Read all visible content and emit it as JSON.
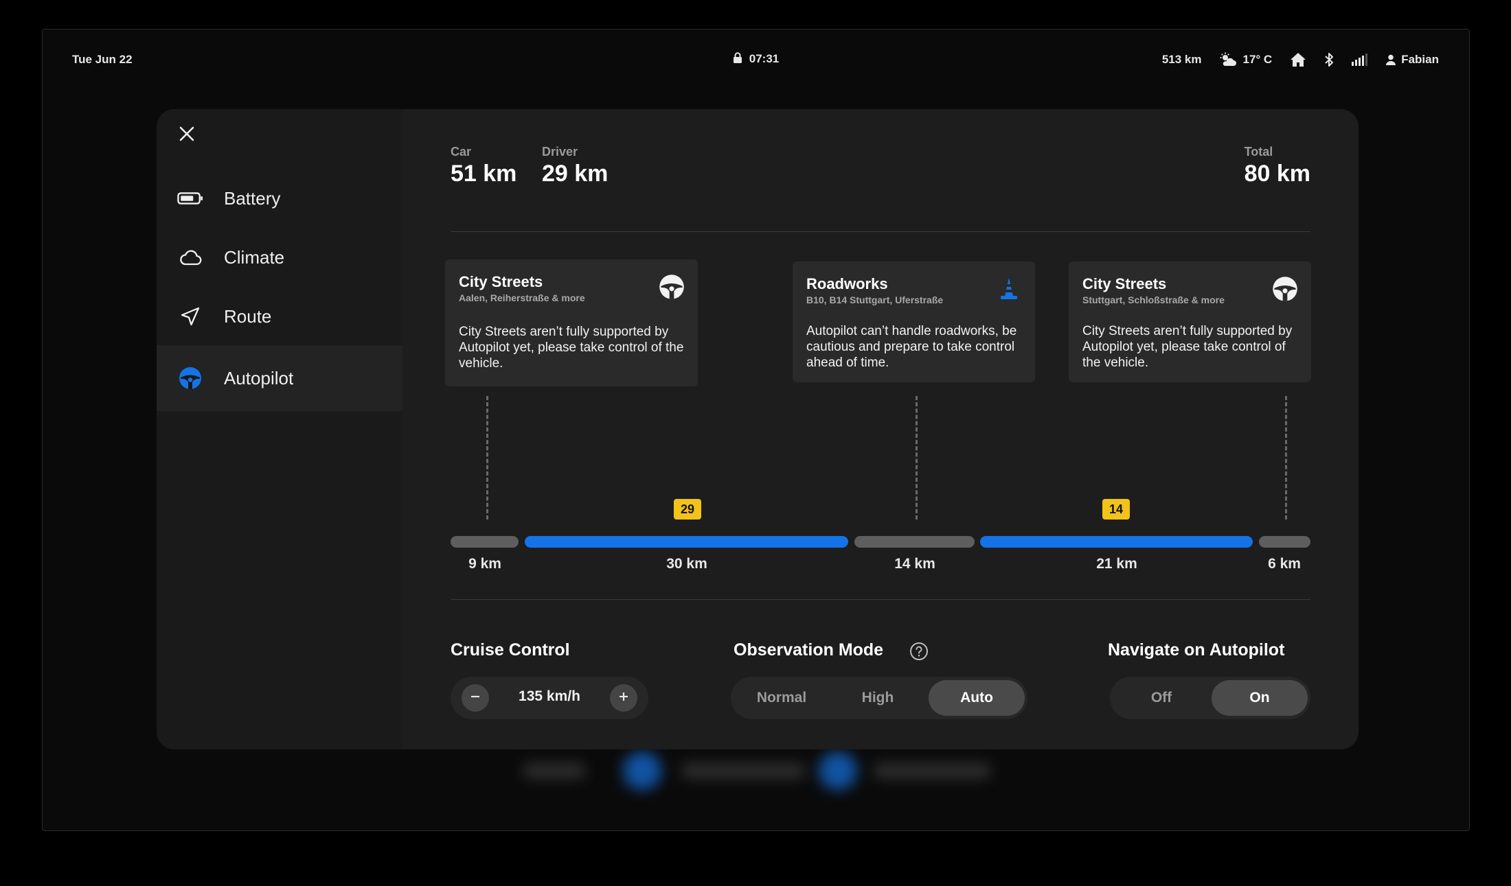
{
  "status": {
    "date": "Tue Jun 22",
    "time": "07:31",
    "range": "513 km",
    "temperature": "17° C",
    "user": "Fabian"
  },
  "sidebar": {
    "items": [
      {
        "label": "Battery",
        "icon": "battery-icon",
        "active": false
      },
      {
        "label": "Climate",
        "icon": "cloud-icon",
        "active": false
      },
      {
        "label": "Route",
        "icon": "navigation-arrow-icon",
        "active": false
      },
      {
        "label": "Autopilot",
        "icon": "steering-wheel-icon",
        "active": true
      }
    ]
  },
  "distances": {
    "car": {
      "label": "Car",
      "value": "51 km"
    },
    "driver": {
      "label": "Driver",
      "value": "29 km"
    },
    "total": {
      "label": "Total",
      "value": "80 km"
    }
  },
  "cards": [
    {
      "title": "City Streets",
      "subtitle": "Aalen, Reiherstraße & more",
      "body": "City Streets aren’t fully supported by Autopilot yet, please take control of the vehicle.",
      "icon": "steering-wheel-icon"
    },
    {
      "title": "Roadworks",
      "subtitle": "B10, B14 Stuttgart, Uferstraße",
      "body": "Autopilot can’t handle roadworks, be cautious and prepare to take control ahead of time.",
      "icon": "traffic-cone-icon"
    },
    {
      "title": "City Streets",
      "subtitle": "Stuttgart, Schloßstraße & more",
      "body": "City Streets aren’t fully supported by Autopilot yet, please take control of the vehicle.",
      "icon": "steering-wheel-icon"
    }
  ],
  "route": {
    "segments": [
      {
        "label": "9 km",
        "type": "driver"
      },
      {
        "label": "30 km",
        "type": "autopilot",
        "badge": "29"
      },
      {
        "label": "14 km",
        "type": "driver"
      },
      {
        "label": "21 km",
        "type": "autopilot",
        "badge": "14"
      },
      {
        "label": "6 km",
        "type": "driver"
      }
    ]
  },
  "controls": {
    "cruise": {
      "title": "Cruise Control",
      "speed": "135 km/h",
      "minus": "−",
      "plus": "+"
    },
    "observation": {
      "title": "Observation Mode",
      "options": [
        "Normal",
        "High",
        "Auto"
      ],
      "selected": "Auto"
    },
    "navigate": {
      "title": "Navigate on Autopilot",
      "options": [
        "Off",
        "On"
      ],
      "selected": "On"
    }
  },
  "colors": {
    "accent": "#1473e6",
    "badge": "#f2c318"
  }
}
